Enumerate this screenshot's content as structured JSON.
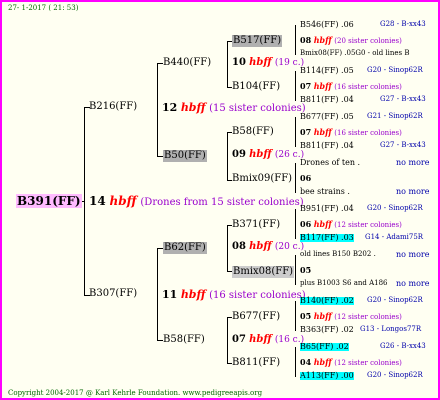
{
  "header": {
    "date": "27-  1-2017 ( 21: 53)"
  },
  "footer": {
    "copyright": "Copyright 2004-2017 @ Karl Kehrle Foundation.   www.pedigreeapis.org"
  },
  "root": {
    "label": "B391(FF)",
    "gen_num": "14",
    "hbff": "hbff",
    "note": "(Drones from 15 sister colonies)"
  },
  "gen1": {
    "top": {
      "label": "B216(FF)",
      "num": "12",
      "hbff": "hbff",
      "note": "(15 sister colonies)"
    },
    "bottom": {
      "label": "B307(FF)",
      "num": "11",
      "hbff": "hbff",
      "note": "(16 sister colonies)"
    }
  },
  "gen2": {
    "a": {
      "label": "B440(FF)",
      "num": "10",
      "hbff": "hbff",
      "note": "(19 c.)"
    },
    "b": {
      "label": "B50(FF)",
      "num": "09",
      "hbff": "hbff",
      "note": "(26 c.)"
    },
    "c": {
      "label": "B62(FF)",
      "num": "08",
      "hbff": "hbff",
      "note": "(20 c.)"
    },
    "d": {
      "label": "B58(FF)",
      "num": "07",
      "hbff": "hbff",
      "note": "(16 c.)"
    }
  },
  "gen3": {
    "a1": "B517(FF)",
    "a2": "B104(FF)",
    "b1": "B58(FF)",
    "b2": "Bmix09(FF)",
    "c1": "B371(FF)",
    "c2": "Bmix08(FF)",
    "d1": "B677(FF)",
    "d2": "B811(FF)"
  },
  "gen4": {
    "r1": {
      "name": "B546(FF) .06",
      "loc": "G28 - B-xx43"
    },
    "r1n": {
      "num": "08",
      "hbff": "hbff",
      "note": "(20 sister colonies)"
    },
    "r2": {
      "name": "Bmix08(FF) .05G0 - old lines B"
    },
    "r3": {
      "name": "B114(FF) .05",
      "loc": "G20 - Sinop62R"
    },
    "r3n": {
      "num": "07",
      "hbff": "hbff",
      "note": "(16 sister colonies)"
    },
    "r4": {
      "name": "B811(FF) .04",
      "loc": "G27 - B-xx43"
    },
    "r5": {
      "name": "B677(FF) .05",
      "loc": "G21 - Sinop62R"
    },
    "r5n": {
      "num": "07",
      "hbff": "hbff",
      "note": "(16 sister colonies)"
    },
    "r6": {
      "name": "B811(FF) .04",
      "loc": "G27 - B-xx43"
    },
    "r7": {
      "name": "Drones of ten .",
      "more": "no more"
    },
    "r7n": {
      "num": "06"
    },
    "r8": {
      "name": "bee strains .",
      "more": "no more"
    },
    "r9": {
      "name": "B951(FF) .04",
      "loc": "G20 - Sinop62R"
    },
    "r9n": {
      "num": "06",
      "hbff": "hbff",
      "note": "(12 sister colonies)"
    },
    "r10": {
      "name": "B117(FF) .03",
      "loc": "G14 - Adami75R"
    },
    "r11": {
      "name": "old lines B150 B202 .",
      "more": "no more"
    },
    "r11n": {
      "num": "05"
    },
    "r12": {
      "name": "plus B1003 S6 and A186",
      "more": "no more"
    },
    "r13": {
      "name": "B140(FF) .02",
      "loc": "G20 - Sinop62R"
    },
    "r13n": {
      "num": "05",
      "hbff": "hbff",
      "note": "(12 sister colonies)"
    },
    "r14": {
      "name": "B363(FF) .02",
      "loc": "G13 - Longos77R"
    },
    "r15": {
      "name": "B65(FF) .02",
      "loc": "G26 - B-xx43"
    },
    "r15n": {
      "num": "04",
      "hbff": "hbff",
      "note": "(12 sister colonies)"
    },
    "r16": {
      "name": "A113(FF) .00",
      "loc": "G20 - Sinop62R"
    }
  },
  "colors": {
    "frame": "#ff00ff",
    "root_highlight": "#ffbbff",
    "gray_highlight": "#b0b0b0",
    "cyan_highlight": "#00ffff",
    "hbff": "#ff0000",
    "note": "#9900cc",
    "gen_loc": "#0000aa",
    "header_footer": "#006600"
  }
}
